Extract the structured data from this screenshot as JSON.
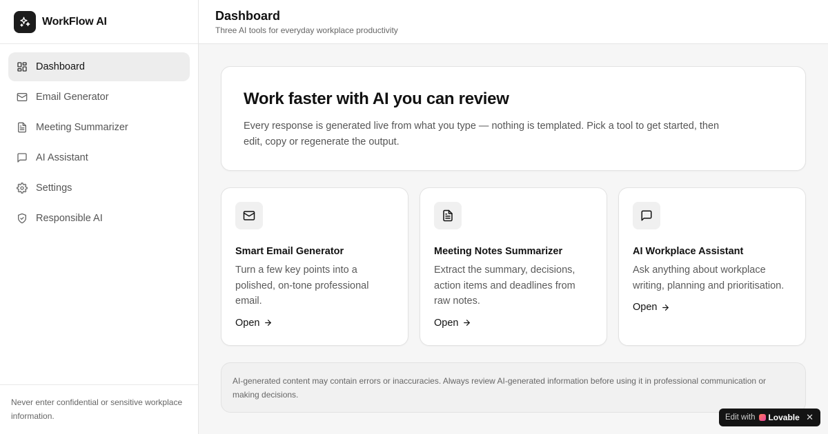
{
  "brand": {
    "name": "WorkFlow AI",
    "icon": "sparkles-icon"
  },
  "nav": [
    {
      "label": "Dashboard",
      "icon": "layout-grid-icon",
      "active": true
    },
    {
      "label": "Email Generator",
      "icon": "mail-icon",
      "active": false
    },
    {
      "label": "Meeting Summarizer",
      "icon": "file-text-icon",
      "active": false
    },
    {
      "label": "AI Assistant",
      "icon": "message-square-icon",
      "active": false
    },
    {
      "label": "Settings",
      "icon": "gear-icon",
      "active": false
    },
    {
      "label": "Responsible AI",
      "icon": "shield-check-icon",
      "active": false
    }
  ],
  "sidebar_footer": "Never enter confidential or sensitive workplace information.",
  "header": {
    "title": "Dashboard",
    "subtitle": "Three AI tools for everyday workplace productivity"
  },
  "hero": {
    "title": "Work faster with AI you can review",
    "text": "Every response is generated live from what you type — nothing is templated. Pick a tool to get started, then edit, copy or regenerate the output."
  },
  "cards": [
    {
      "icon": "mail-icon",
      "title": "Smart Email Generator",
      "text": "Turn a few key points into a polished, on-tone professional email.",
      "action": "Open"
    },
    {
      "icon": "file-text-icon",
      "title": "Meeting Notes Summarizer",
      "text": "Extract the summary, decisions, action items and deadlines from raw notes.",
      "action": "Open"
    },
    {
      "icon": "message-square-icon",
      "title": "AI Workplace Assistant",
      "text": "Ask anything about workplace writing, planning and prioritisation.",
      "action": "Open"
    }
  ],
  "disclaimer": "AI-generated content may contain errors or inaccuracies. Always review AI-generated information before using it in professional communication or making decisions.",
  "badge": {
    "prefix": "Edit with",
    "brand": "Lovable",
    "close": "✕"
  },
  "colors": {
    "accent": "#1c1c1c",
    "active_bg": "#ededed",
    "page_bg": "#f6f6f6"
  }
}
